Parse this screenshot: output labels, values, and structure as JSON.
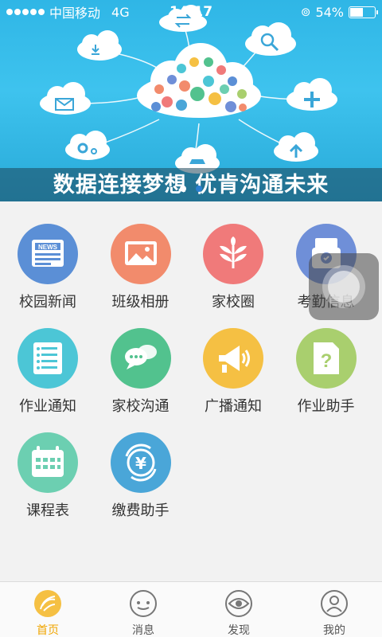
{
  "status_bar": {
    "carrier": "中国移动",
    "network": "4G",
    "time": "14:17",
    "battery_text": "54%",
    "battery_level": 0.54
  },
  "banner": {
    "caption": "数据连接梦想  优肯沟通未来"
  },
  "grid": {
    "items": [
      {
        "label": "校园新闻",
        "color": "#5b8fd6",
        "icon": "news-icon"
      },
      {
        "label": "班级相册",
        "color": "#f28b6c",
        "icon": "photo-album-icon"
      },
      {
        "label": "家校圈",
        "color": "#f07a7a",
        "icon": "leaf-icon"
      },
      {
        "label": "考勤信息",
        "color": "#6f8fd8",
        "icon": "attendance-icon"
      },
      {
        "label": "作业通知",
        "color": "#4cc6d6",
        "icon": "list-icon"
      },
      {
        "label": "家校沟通",
        "color": "#52c28e",
        "icon": "chat-icon"
      },
      {
        "label": "广播通知",
        "color": "#f5c043",
        "icon": "megaphone-icon"
      },
      {
        "label": "作业助手",
        "color": "#a9cf6e",
        "icon": "help-document-icon"
      },
      {
        "label": "课程表",
        "color": "#6ccfb1",
        "icon": "calendar-icon"
      },
      {
        "label": "缴费助手",
        "color": "#4aa6d8",
        "icon": "yuan-payment-icon"
      }
    ]
  },
  "tabbar": {
    "tabs": [
      {
        "label": "首页",
        "icon": "home-icon",
        "active": true
      },
      {
        "label": "消息",
        "icon": "message-icon",
        "active": false
      },
      {
        "label": "发现",
        "icon": "eye-icon",
        "active": false
      },
      {
        "label": "我的",
        "icon": "profile-icon",
        "active": false
      }
    ],
    "active_color": "#f0a500"
  }
}
